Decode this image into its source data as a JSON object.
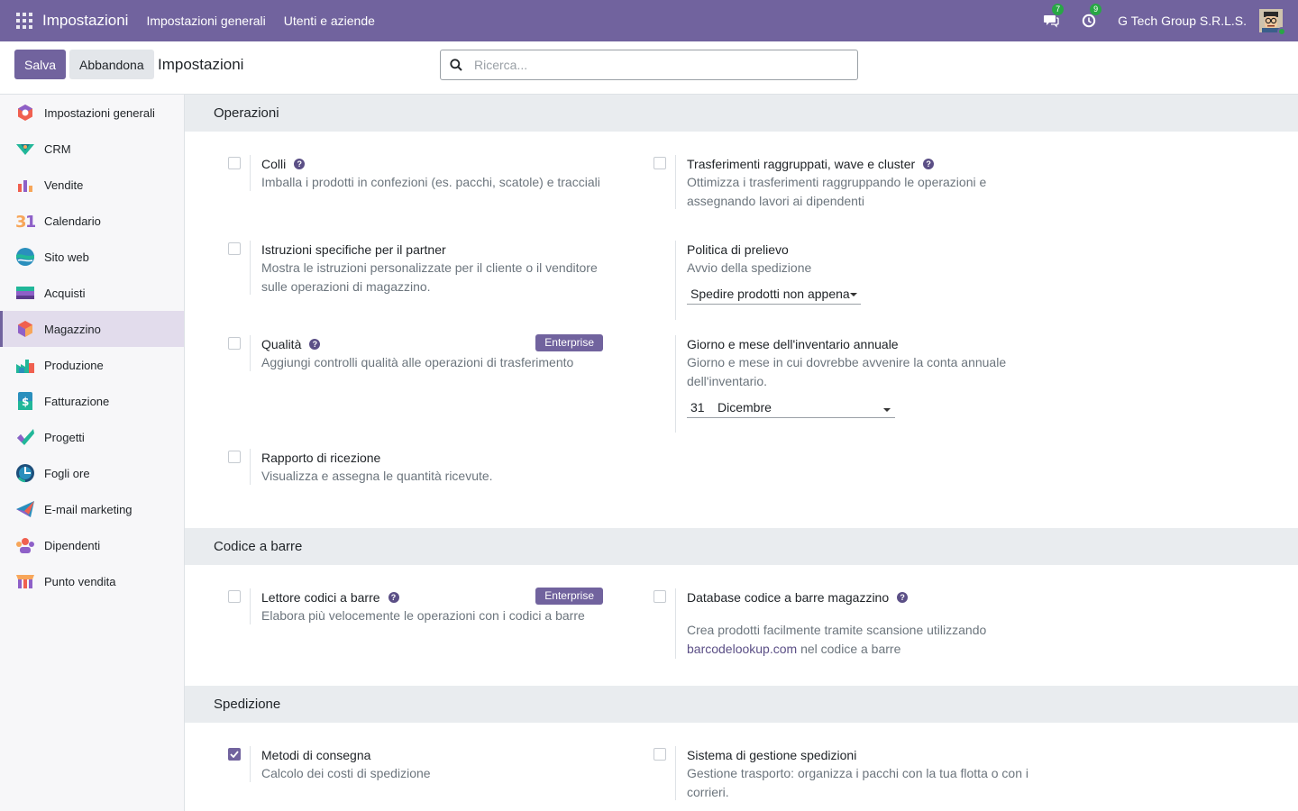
{
  "topbar": {
    "app_title": "Impostazioni",
    "menu": [
      "Impostazioni generali",
      "Utenti e aziende"
    ],
    "messages_count": "7",
    "activities_count": "9",
    "company": "G Tech Group S.R.L.S."
  },
  "control": {
    "save_label": "Salva",
    "discard_label": "Abbandona",
    "title": "Impostazioni",
    "search_placeholder": "Ricerca..."
  },
  "sidebar": {
    "items": [
      {
        "label": "Impostazioni generali",
        "icon": "general-settings-icon"
      },
      {
        "label": "CRM",
        "icon": "crm-icon"
      },
      {
        "label": "Vendite",
        "icon": "sales-icon"
      },
      {
        "label": "Calendario",
        "icon": "calendar-icon"
      },
      {
        "label": "Sito web",
        "icon": "website-icon"
      },
      {
        "label": "Acquisti",
        "icon": "purchase-icon"
      },
      {
        "label": "Magazzino",
        "icon": "inventory-icon",
        "active": true
      },
      {
        "label": "Produzione",
        "icon": "manufacturing-icon"
      },
      {
        "label": "Fatturazione",
        "icon": "invoicing-icon"
      },
      {
        "label": "Progetti",
        "icon": "project-icon"
      },
      {
        "label": "Fogli ore",
        "icon": "timesheet-icon"
      },
      {
        "label": "E-mail marketing",
        "icon": "email-marketing-icon"
      },
      {
        "label": "Dipendenti",
        "icon": "employees-icon"
      },
      {
        "label": "Punto vendita",
        "icon": "pos-icon"
      }
    ]
  },
  "sections": {
    "operations": {
      "title": "Operazioni",
      "packages": {
        "title": "Colli",
        "desc": "Imballa i prodotti in confezioni (es. pacchi, scatole) e tracciali",
        "checked": false
      },
      "wave": {
        "title": "Trasferimenti raggruppati, wave e cluster",
        "desc": "Ottimizza i trasferimenti raggruppando le operazioni e assegnando lavori ai dipendenti",
        "checked": false
      },
      "partner": {
        "title": "Istruzioni specifiche per il partner",
        "desc": "Mostra le istruzioni personalizzate per il cliente o il venditore sulle operazioni di magazzino.",
        "checked": false
      },
      "picking_policy": {
        "title": "Politica di prelievo",
        "desc": "Avvio della spedizione",
        "value": "Spedire prodotti non appena"
      },
      "quality": {
        "title": "Qualità",
        "desc": "Aggiungi controlli qualità alle operazioni di trasferimento",
        "badge": "Enterprise",
        "checked": false
      },
      "inventory_date": {
        "title": "Giorno e mese dell'inventario annuale",
        "desc": "Giorno e mese in cui dovrebbe avvenire la conta annuale dell'inventario.",
        "day": "31",
        "month": "Dicembre"
      },
      "reception": {
        "title": "Rapporto di ricezione",
        "desc": "Visualizza e assegna le quantità ricevute.",
        "checked": false
      }
    },
    "barcode": {
      "title": "Codice a barre",
      "scanner": {
        "title": "Lettore codici a barre",
        "desc": "Elabora più velocemente le operazioni con i codici a barre",
        "badge": "Enterprise",
        "checked": false
      },
      "database": {
        "title": "Database codice a barre magazzino",
        "desc_pre": "Crea prodotti facilmente tramite scansione utilizzando",
        "link": "barcodelookup.com",
        "desc_post": " nel codice a barre",
        "checked": false
      }
    },
    "shipping": {
      "title": "Spedizione",
      "delivery": {
        "title": "Metodi di consegna",
        "desc": "Calcolo dei costi di spedizione",
        "checked": true
      },
      "dispatch": {
        "title": "Sistema di gestione spedizioni",
        "desc": "Gestione trasporto: organizza i pacchi con la tua flotta o con i corrieri.",
        "checked": false
      }
    }
  },
  "colors": {
    "brand": "#71639e",
    "success": "#28a745"
  }
}
